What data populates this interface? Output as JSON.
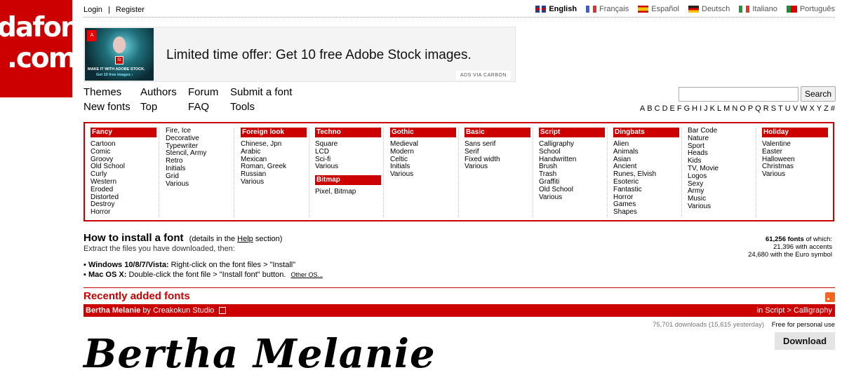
{
  "logo": {
    "line1": "dafont",
    "line2": ".com"
  },
  "auth": {
    "login": "Login",
    "separator": "|",
    "register": "Register"
  },
  "languages": [
    {
      "label": "English",
      "active": true,
      "flag_color": "#1f3f8f"
    },
    {
      "label": "Français",
      "active": false,
      "flag_color": "#3a5fd0"
    },
    {
      "label": "Español",
      "active": false,
      "flag_color": "#e0b400"
    },
    {
      "label": "Deutsch",
      "active": false,
      "flag_color": "#c9a000"
    },
    {
      "label": "Italiano",
      "active": false,
      "flag_color": "#1e9a3a"
    },
    {
      "label": "Português",
      "active": false,
      "flag_color": "#1e8a3a"
    }
  ],
  "ad": {
    "text": "Limited time offer: Get 10 free Adobe Stock images.",
    "image_line1": "MAKE IT WITH ADOBE STOCK.",
    "image_line2": "Get 10 free images ›",
    "via": "ADS VIA CARBON"
  },
  "nav": {
    "themes": "Themes",
    "authors": "Authors",
    "forum": "Forum",
    "submit": "Submit a font",
    "new_fonts": "New fonts",
    "top": "Top",
    "faq": "FAQ",
    "tools": "Tools"
  },
  "search": {
    "button": "Search",
    "placeholder": ""
  },
  "alphabet": [
    "A",
    "B",
    "C",
    "D",
    "E",
    "F",
    "G",
    "H",
    "I",
    "J",
    "K",
    "L",
    "M",
    "N",
    "O",
    "P",
    "Q",
    "R",
    "S",
    "T",
    "U",
    "V",
    "W",
    "X",
    "Y",
    "Z",
    "#"
  ],
  "categories": {
    "fancy": {
      "head": "Fancy",
      "items": [
        "Cartoon",
        "Comic",
        "Groovy",
        "Old School",
        "Curly",
        "Western",
        "Eroded",
        "Distorted",
        "Destroy",
        "Horror"
      ]
    },
    "fancy2": {
      "items": [
        "Fire, Ice",
        "Decorative",
        "Typewriter",
        "Stencil, Army",
        "Retro",
        "Initials",
        "Grid",
        "Various"
      ]
    },
    "foreign": {
      "head": "Foreign look",
      "items": [
        "Chinese, Jpn",
        "Arabic",
        "Mexican",
        "Roman, Greek",
        "Russian",
        "Various"
      ]
    },
    "techno": {
      "head": "Techno",
      "items": [
        "Square",
        "LCD",
        "Sci-fi",
        "Various"
      ]
    },
    "bitmap": {
      "head": "Bitmap",
      "items": [
        "Pixel, Bitmap"
      ]
    },
    "gothic": {
      "head": "Gothic",
      "items": [
        "Medieval",
        "Modern",
        "Celtic",
        "Initials",
        "Various"
      ]
    },
    "basic": {
      "head": "Basic",
      "items": [
        "Sans serif",
        "Serif",
        "Fixed width",
        "Various"
      ]
    },
    "script": {
      "head": "Script",
      "items": [
        "Calligraphy",
        "School",
        "Handwritten",
        "Brush",
        "Trash",
        "Graffiti",
        "Old School",
        "Various"
      ]
    },
    "dingbats": {
      "head": "Dingbats",
      "items": [
        "Alien",
        "Animals",
        "Asian",
        "Ancient",
        "Runes, Elvish",
        "Esoteric",
        "Fantastic",
        "Horror",
        "Games",
        "Shapes"
      ]
    },
    "dingbats2": {
      "items": [
        "Bar Code",
        "Nature",
        "Sport",
        "Heads",
        "Kids",
        "TV, Movie",
        "Logos",
        "Sexy",
        "Army",
        "Music",
        "Various"
      ]
    },
    "holiday": {
      "head": "Holiday",
      "items": [
        "Valentine",
        "Easter",
        "Halloween",
        "Christmas",
        "Various"
      ]
    }
  },
  "install": {
    "title": "How to install a font",
    "note_pre": "(details in the",
    "note_link": "Help",
    "note_post": "section)",
    "sub": "Extract the files you have downloaded, then:",
    "win_label": "Windows 10/8/7/Vista:",
    "win_text": "Right-click on the font files > \"Install\"",
    "mac_label": "Mac OS X:",
    "mac_text": "Double-click the font file > \"Install font\" button.",
    "other": "Other OS..."
  },
  "stats": {
    "total": "61,256 fonts",
    "total_suffix": "of which:",
    "accents": "21,396 with accents",
    "euro": "24,680 with the Euro symbol"
  },
  "recent": {
    "title": "Recently added fonts"
  },
  "font": {
    "name": "Bertha Melanie",
    "by": "by Creakokun Studio",
    "category": "in Script > Calligraphy",
    "downloads": "75,701 downloads (15,615 yesterday)",
    "license": "Free for personal use",
    "download_button": "Download",
    "preview": "Bertha Melanie"
  },
  "colors": {
    "brand": "#cc0000",
    "rss": "#f26522"
  }
}
